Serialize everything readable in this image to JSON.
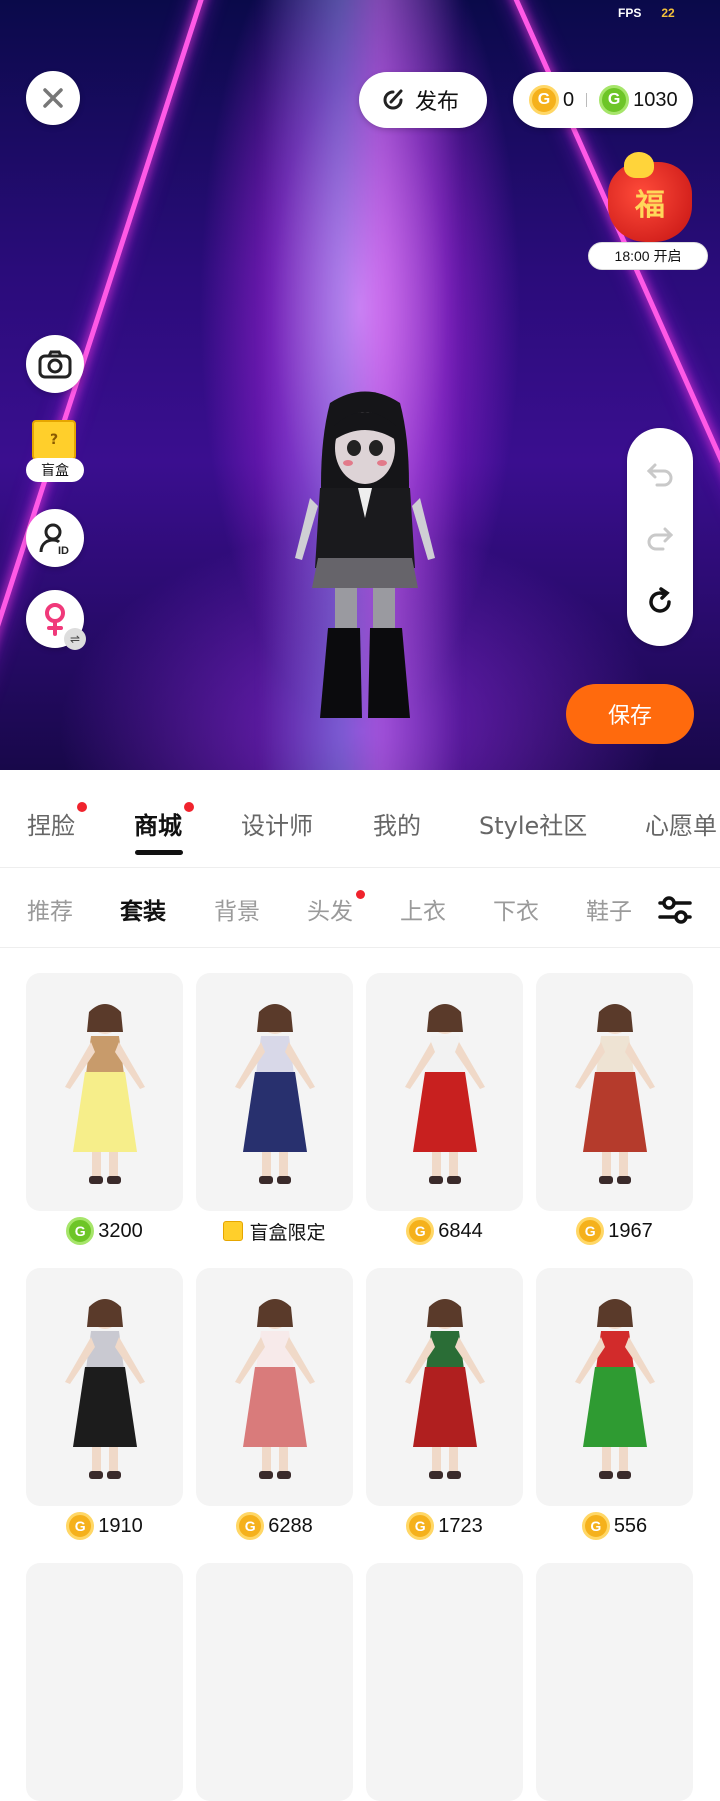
{
  "fps": {
    "label": "FPS",
    "value": "22"
  },
  "top": {
    "publish_label": "发布",
    "gold_balance": "0",
    "green_balance": "1030",
    "gold_coin_symbol": "G",
    "green_coin_symbol": "G"
  },
  "event": {
    "badge_char": "福",
    "time_label": "18:00 开启"
  },
  "side": {
    "blind_box_label": "盲盒",
    "blind_box_symbol": "?"
  },
  "save_label": "保存",
  "tabs": [
    {
      "label": "捏脸",
      "dot": true
    },
    {
      "label": "商城",
      "dot": true,
      "active": true
    },
    {
      "label": "设计师"
    },
    {
      "label": "我的"
    },
    {
      "label": "Style社区"
    },
    {
      "label": "心愿单"
    }
  ],
  "subtabs": [
    {
      "label": "推荐"
    },
    {
      "label": "套装",
      "active": true
    },
    {
      "label": "背景"
    },
    {
      "label": "头发",
      "dot": true
    },
    {
      "label": "上衣"
    },
    {
      "label": "下衣"
    },
    {
      "label": "鞋子"
    }
  ],
  "items": [
    {
      "price": "3200",
      "currency": "green",
      "outfit": "yellow-dress",
      "colors": [
        "#f6ee8a",
        "#c89b6b"
      ]
    },
    {
      "price": "盲盒限定",
      "currency": "blindbox",
      "outfit": "dark-fantasy",
      "colors": [
        "#28306e",
        "#d8d8e8"
      ]
    },
    {
      "price": "6844",
      "currency": "gold",
      "outfit": "red-hanfu",
      "colors": [
        "#c8201f",
        "#f2f2f2"
      ]
    },
    {
      "price": "1967",
      "currency": "gold",
      "outfit": "cream-red-dress",
      "colors": [
        "#b53b2c",
        "#eee3d3"
      ]
    },
    {
      "price": "1910",
      "currency": "gold",
      "outfit": "witch",
      "colors": [
        "#1c1c1c",
        "#c9c9d1"
      ]
    },
    {
      "price": "6288",
      "currency": "gold",
      "outfit": "snow-princess",
      "colors": [
        "#d97b7b",
        "#f7eaea"
      ]
    },
    {
      "price": "1723",
      "currency": "gold",
      "outfit": "christmas",
      "colors": [
        "#b01f1f",
        "#2a6d36"
      ]
    },
    {
      "price": "556",
      "currency": "gold",
      "outfit": "xmas-tree",
      "colors": [
        "#2f9b32",
        "#d22b2b"
      ]
    }
  ]
}
